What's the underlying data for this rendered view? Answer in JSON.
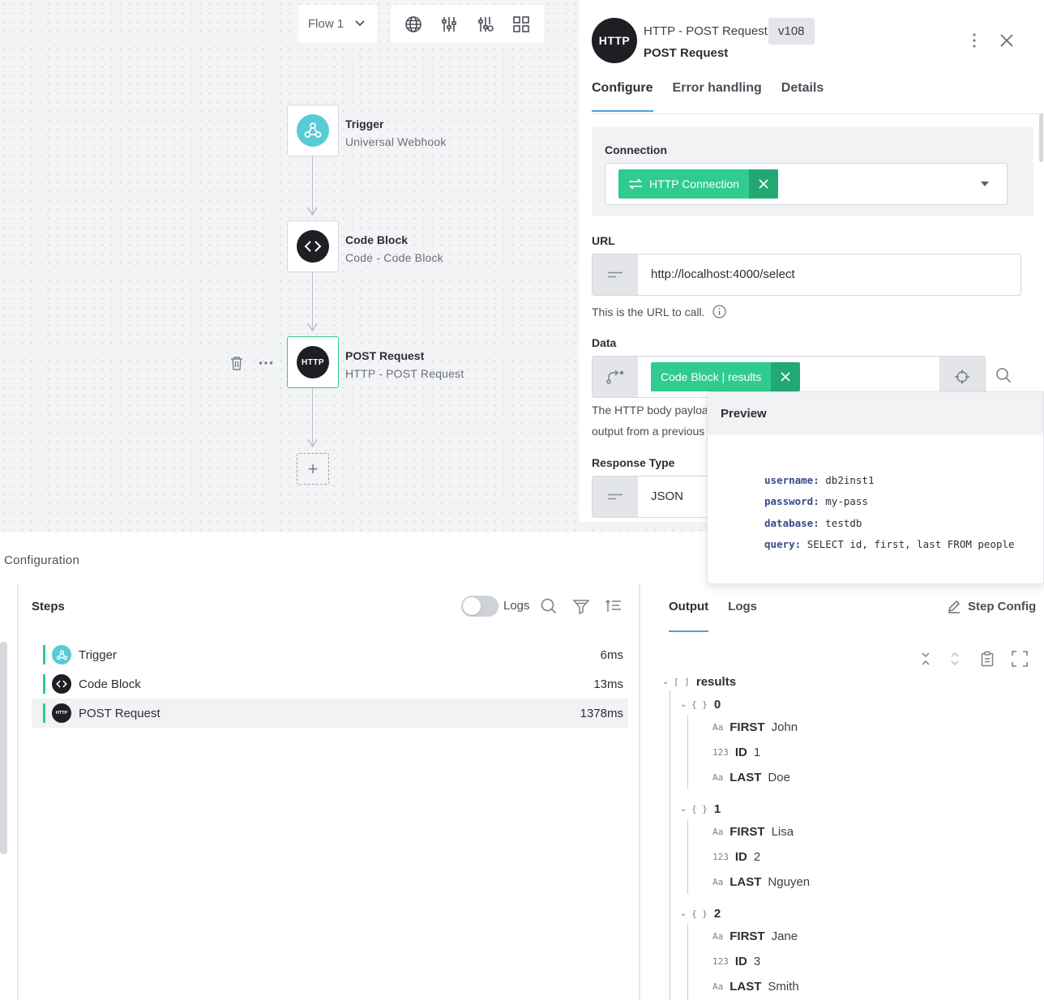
{
  "canvas": {
    "flow_select": "Flow 1",
    "nodes": [
      {
        "title": "Trigger",
        "subtitle": "Universal Webhook"
      },
      {
        "title": "Code Block",
        "subtitle": "Code - Code Block"
      },
      {
        "title": "POST Request",
        "subtitle": "HTTP - POST Request",
        "icon_text": "HTTP"
      }
    ]
  },
  "panel": {
    "icon_text": "HTTP",
    "subtitle": "HTTP - POST Request",
    "version": "v108",
    "title": "POST Request",
    "tabs": [
      "Configure",
      "Error handling",
      "Details"
    ],
    "connection": {
      "label": "Connection",
      "chip": "HTTP Connection"
    },
    "url": {
      "label": "URL",
      "value": "http://localhost:4000/select",
      "helper": "This is the URL to call."
    },
    "data": {
      "label": "Data",
      "chip": "Code Block | results",
      "helper_line1": "The HTTP body payloa",
      "helper_line2": "output from a previous"
    },
    "response_type": {
      "label": "Response Type",
      "value": "JSON"
    }
  },
  "preview": {
    "title": "Preview",
    "rows": [
      {
        "key": "username:",
        "value": "db2inst1"
      },
      {
        "key": "password:",
        "value": "my-pass"
      },
      {
        "key": "database:",
        "value": "testdb"
      },
      {
        "key": "query:",
        "value": "SELECT id, first, last FROM people"
      }
    ]
  },
  "bottom": {
    "config_label": "Configuration",
    "steps_title": "Steps",
    "logs_toggle_label": "Logs",
    "steps": [
      {
        "name": "Trigger",
        "duration": "6ms"
      },
      {
        "name": "Code Block",
        "duration": "13ms"
      },
      {
        "name": "POST Request",
        "duration": "1378ms",
        "icon_text": "HTTP"
      }
    ],
    "output_tabs": [
      "Output",
      "Logs"
    ],
    "step_config": "Step Config",
    "tree": {
      "root": "results",
      "items": [
        {
          "index": "0",
          "fields": [
            {
              "type": "Aa",
              "key": "FIRST",
              "value": "John"
            },
            {
              "type": "123",
              "key": "ID",
              "value": "1"
            },
            {
              "type": "Aa",
              "key": "LAST",
              "value": "Doe"
            }
          ]
        },
        {
          "index": "1",
          "fields": [
            {
              "type": "Aa",
              "key": "FIRST",
              "value": "Lisa"
            },
            {
              "type": "123",
              "key": "ID",
              "value": "2"
            },
            {
              "type": "Aa",
              "key": "LAST",
              "value": "Nguyen"
            }
          ]
        },
        {
          "index": "2",
          "fields": [
            {
              "type": "Aa",
              "key": "FIRST",
              "value": "Jane"
            },
            {
              "type": "123",
              "key": "ID",
              "value": "3"
            },
            {
              "type": "Aa",
              "key": "LAST",
              "value": "Smith"
            }
          ]
        }
      ]
    }
  },
  "colors": {
    "accent_green": "#2fcb8f",
    "accent_blue": "#4aa3df",
    "dark_icon": "#1d1f24",
    "teal_icon": "#57ccd6"
  }
}
